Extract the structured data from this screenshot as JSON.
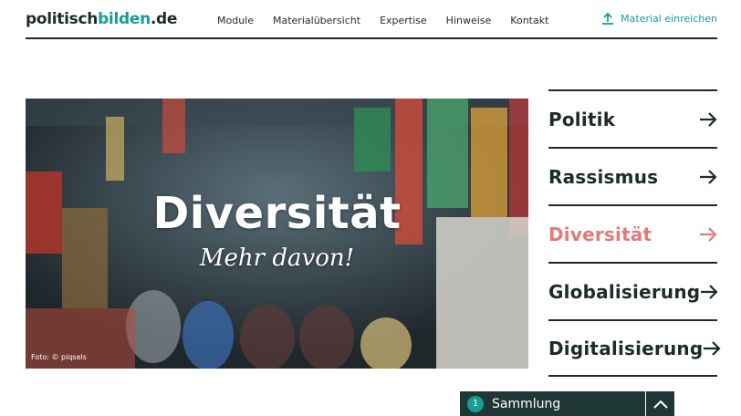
{
  "logo": {
    "part1": "politisch",
    "part2": "bilden",
    "part3": ".de"
  },
  "nav": [
    "Module",
    "Materialübersicht",
    "Expertise",
    "Hinweise",
    "Kontakt"
  ],
  "submit": {
    "label": "Material einreichen",
    "icon": "upload-icon"
  },
  "hero": {
    "title": "Diversität",
    "subtitle": "Mehr davon!",
    "credit": "Foto: © piqsels"
  },
  "topics": [
    {
      "label": "Politik",
      "active": false
    },
    {
      "label": "Rassismus",
      "active": false
    },
    {
      "label": "Diversität",
      "active": true
    },
    {
      "label": "Globalisierung",
      "active": false
    },
    {
      "label": "Digitalisierung",
      "active": false
    }
  ],
  "collection": {
    "count": "1",
    "label": "Sammlung"
  },
  "colors": {
    "accent": "#1a9c94",
    "active_topic": "#e07b78",
    "text": "#1d2b2b",
    "bar": "#1f3836"
  }
}
